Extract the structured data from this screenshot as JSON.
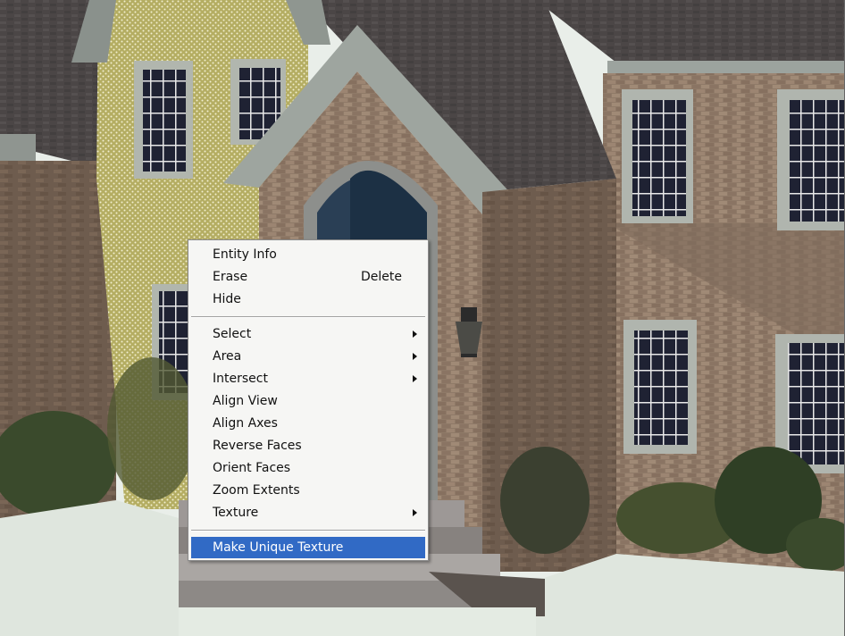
{
  "scene": {
    "description_icon": "house-3d-model-icon"
  },
  "context_menu": {
    "groups": [
      [
        {
          "label": "Entity Info",
          "shortcut": "",
          "submenu": false
        },
        {
          "label": "Erase",
          "shortcut": "Delete",
          "submenu": false
        },
        {
          "label": "Hide",
          "shortcut": "",
          "submenu": false
        }
      ],
      [
        {
          "label": "Select",
          "shortcut": "",
          "submenu": true
        },
        {
          "label": "Area",
          "shortcut": "",
          "submenu": true
        },
        {
          "label": "Intersect",
          "shortcut": "",
          "submenu": true
        },
        {
          "label": "Align View",
          "shortcut": "",
          "submenu": false
        },
        {
          "label": "Align Axes",
          "shortcut": "",
          "submenu": false
        },
        {
          "label": "Reverse Faces",
          "shortcut": "",
          "submenu": false
        },
        {
          "label": "Orient Faces",
          "shortcut": "",
          "submenu": false
        },
        {
          "label": "Zoom Extents",
          "shortcut": "",
          "submenu": false
        },
        {
          "label": "Texture",
          "shortcut": "",
          "submenu": true
        }
      ],
      [
        {
          "label": "Make Unique Texture",
          "shortcut": "",
          "submenu": false,
          "highlighted": true
        }
      ]
    ],
    "highlight_color": "#316ac5"
  }
}
